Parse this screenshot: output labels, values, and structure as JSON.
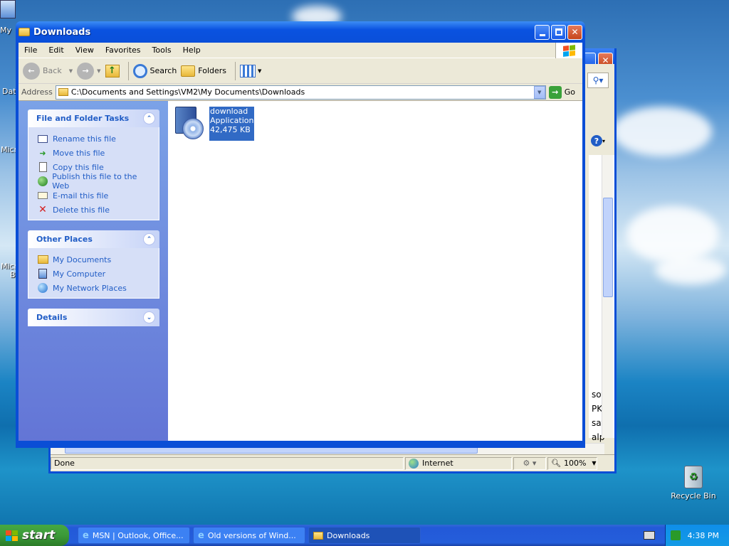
{
  "window": {
    "title": "Downloads",
    "menu": [
      "File",
      "Edit",
      "View",
      "Favorites",
      "Tools",
      "Help"
    ],
    "toolbar": {
      "back": "Back",
      "search": "Search",
      "folders": "Folders"
    },
    "address": {
      "label": "Address",
      "value": "C:\\Documents and Settings\\VM2\\My Documents\\Downloads",
      "go": "Go"
    }
  },
  "left_pane": {
    "file_tasks": {
      "title": "File and Folder Tasks",
      "items": [
        "Rename this file",
        "Move this file",
        "Copy this file",
        "Publish this file to the Web",
        "E-mail this file",
        "Delete this file"
      ]
    },
    "other_places": {
      "title": "Other Places",
      "items": [
        "My Documents",
        "My Computer",
        "My Network Places"
      ]
    },
    "details": {
      "title": "Details"
    }
  },
  "file": {
    "name": "download",
    "type": "Application",
    "size": "42,475 KB"
  },
  "background_window": {
    "status": "Done",
    "zone": "Internet",
    "zoom": "100%",
    "snippets": [
      "sof",
      "PK",
      "saf",
      "alp"
    ]
  },
  "desktop": {
    "recycle_bin": "Recycle Bin",
    "partial_labels": [
      "My",
      "Dat",
      "Micr",
      "Micr",
      "B"
    ]
  },
  "taskbar": {
    "start": "start",
    "tasks": [
      "MSN | Outlook, Office...",
      "Old versions of Wind...",
      "Downloads"
    ],
    "clock": "4:38 PM"
  }
}
